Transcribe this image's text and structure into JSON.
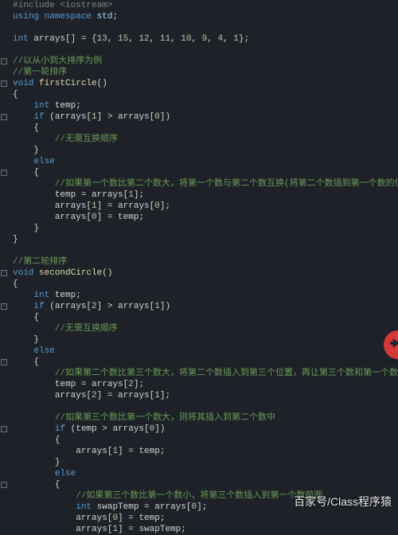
{
  "lines": [
    {
      "ind": 0,
      "fold": "",
      "tokens": [
        {
          "c": "gray",
          "t": "#include "
        },
        {
          "c": "gray",
          "t": "<iostream>"
        }
      ]
    },
    {
      "ind": 0,
      "fold": "",
      "tokens": [
        {
          "c": "kw",
          "t": "using"
        },
        {
          "c": "",
          "t": " "
        },
        {
          "c": "kw",
          "t": "namespace"
        },
        {
          "c": "",
          "t": " "
        },
        {
          "c": "ns",
          "t": "std"
        },
        {
          "c": "",
          "t": ";"
        }
      ]
    },
    {
      "ind": 0,
      "fold": "",
      "tokens": []
    },
    {
      "ind": 0,
      "fold": "",
      "tokens": [
        {
          "c": "type",
          "t": "int"
        },
        {
          "c": "",
          "t": " "
        },
        {
          "c": "ident",
          "t": "arrays"
        },
        {
          "c": "",
          "t": "[] = {"
        },
        {
          "c": "num",
          "t": "13"
        },
        {
          "c": "",
          "t": ", "
        },
        {
          "c": "num",
          "t": "15"
        },
        {
          "c": "",
          "t": ", "
        },
        {
          "c": "num",
          "t": "12"
        },
        {
          "c": "",
          "t": ", "
        },
        {
          "c": "num",
          "t": "11"
        },
        {
          "c": "",
          "t": ", "
        },
        {
          "c": "num",
          "t": "10"
        },
        {
          "c": "",
          "t": ", "
        },
        {
          "c": "num",
          "t": "9"
        },
        {
          "c": "",
          "t": ", "
        },
        {
          "c": "num",
          "t": "4"
        },
        {
          "c": "",
          "t": ", "
        },
        {
          "c": "num",
          "t": "1"
        },
        {
          "c": "",
          "t": "};"
        }
      ]
    },
    {
      "ind": 0,
      "fold": "",
      "tokens": []
    },
    {
      "ind": 0,
      "fold": "minus",
      "tokens": [
        {
          "c": "comment",
          "t": "//以从小到大排序为例"
        }
      ]
    },
    {
      "ind": 0,
      "fold": "",
      "tokens": [
        {
          "c": "comment",
          "t": "//第一轮排序"
        }
      ]
    },
    {
      "ind": 0,
      "fold": "minus",
      "tokens": [
        {
          "c": "type",
          "t": "void"
        },
        {
          "c": "",
          "t": " "
        },
        {
          "c": "func",
          "t": "firstCircle"
        },
        {
          "c": "",
          "t": "()"
        }
      ]
    },
    {
      "ind": 0,
      "fold": "",
      "tokens": [
        {
          "c": "",
          "t": "{"
        }
      ]
    },
    {
      "ind": 1,
      "fold": "",
      "tokens": [
        {
          "c": "type",
          "t": "int"
        },
        {
          "c": "",
          "t": " "
        },
        {
          "c": "ident",
          "t": "temp"
        },
        {
          "c": "",
          "t": ";"
        }
      ]
    },
    {
      "ind": 1,
      "fold": "minus",
      "tokens": [
        {
          "c": "kw",
          "t": "if"
        },
        {
          "c": "",
          "t": " ("
        },
        {
          "c": "ident",
          "t": "arrays"
        },
        {
          "c": "",
          "t": "["
        },
        {
          "c": "num",
          "t": "1"
        },
        {
          "c": "",
          "t": "] > "
        },
        {
          "c": "ident",
          "t": "arrays"
        },
        {
          "c": "",
          "t": "["
        },
        {
          "c": "num",
          "t": "0"
        },
        {
          "c": "",
          "t": "])"
        }
      ]
    },
    {
      "ind": 1,
      "fold": "",
      "tokens": [
        {
          "c": "",
          "t": "{"
        }
      ]
    },
    {
      "ind": 2,
      "fold": "",
      "tokens": [
        {
          "c": "comment",
          "t": "//无需互换顺序"
        }
      ]
    },
    {
      "ind": 1,
      "fold": "",
      "tokens": [
        {
          "c": "",
          "t": "}"
        }
      ]
    },
    {
      "ind": 1,
      "fold": "",
      "tokens": [
        {
          "c": "kw",
          "t": "else"
        }
      ]
    },
    {
      "ind": 1,
      "fold": "minus",
      "tokens": [
        {
          "c": "",
          "t": "{"
        }
      ]
    },
    {
      "ind": 2,
      "fold": "",
      "tokens": [
        {
          "c": "comment",
          "t": "//如果第一个数比第二个数大，将第一个数与第二个数互换(将第二个数插到第一个数的位置)"
        }
      ]
    },
    {
      "ind": 2,
      "fold": "",
      "tokens": [
        {
          "c": "ident",
          "t": "temp"
        },
        {
          "c": "",
          "t": " = "
        },
        {
          "c": "ident",
          "t": "arrays"
        },
        {
          "c": "",
          "t": "["
        },
        {
          "c": "num",
          "t": "1"
        },
        {
          "c": "",
          "t": "];"
        }
      ]
    },
    {
      "ind": 2,
      "fold": "",
      "tokens": [
        {
          "c": "ident",
          "t": "arrays"
        },
        {
          "c": "",
          "t": "["
        },
        {
          "c": "num",
          "t": "1"
        },
        {
          "c": "",
          "t": "] = "
        },
        {
          "c": "ident",
          "t": "arrays"
        },
        {
          "c": "",
          "t": "["
        },
        {
          "c": "num",
          "t": "0"
        },
        {
          "c": "",
          "t": "];"
        }
      ]
    },
    {
      "ind": 2,
      "fold": "",
      "tokens": [
        {
          "c": "ident",
          "t": "arrays"
        },
        {
          "c": "",
          "t": "["
        },
        {
          "c": "num",
          "t": "0"
        },
        {
          "c": "",
          "t": "] = "
        },
        {
          "c": "ident",
          "t": "temp"
        },
        {
          "c": "",
          "t": ";"
        }
      ]
    },
    {
      "ind": 1,
      "fold": "",
      "tokens": [
        {
          "c": "",
          "t": "}"
        }
      ]
    },
    {
      "ind": 0,
      "fold": "",
      "tokens": [
        {
          "c": "",
          "t": "}"
        }
      ]
    },
    {
      "ind": 0,
      "fold": "",
      "tokens": []
    },
    {
      "ind": 0,
      "fold": "",
      "tokens": [
        {
          "c": "comment",
          "t": "//第二轮排序"
        }
      ]
    },
    {
      "ind": 0,
      "fold": "minus",
      "tokens": [
        {
          "c": "type",
          "t": "void"
        },
        {
          "c": "",
          "t": " "
        },
        {
          "c": "func",
          "t": "secondCircle"
        },
        {
          "c": "",
          "t": "()"
        }
      ]
    },
    {
      "ind": 0,
      "fold": "",
      "tokens": [
        {
          "c": "",
          "t": "{"
        }
      ]
    },
    {
      "ind": 1,
      "fold": "",
      "tokens": [
        {
          "c": "type",
          "t": "int"
        },
        {
          "c": "",
          "t": " "
        },
        {
          "c": "ident",
          "t": "temp"
        },
        {
          "c": "",
          "t": ";"
        }
      ]
    },
    {
      "ind": 1,
      "fold": "minus",
      "tokens": [
        {
          "c": "kw",
          "t": "if"
        },
        {
          "c": "",
          "t": " ("
        },
        {
          "c": "ident",
          "t": "arrays"
        },
        {
          "c": "",
          "t": "["
        },
        {
          "c": "num",
          "t": "2"
        },
        {
          "c": "",
          "t": "] > "
        },
        {
          "c": "ident",
          "t": "arrays"
        },
        {
          "c": "",
          "t": "["
        },
        {
          "c": "num",
          "t": "1"
        },
        {
          "c": "",
          "t": "])"
        }
      ]
    },
    {
      "ind": 1,
      "fold": "",
      "tokens": [
        {
          "c": "",
          "t": "{"
        }
      ]
    },
    {
      "ind": 2,
      "fold": "",
      "tokens": [
        {
          "c": "comment",
          "t": "//无需互换顺序"
        }
      ]
    },
    {
      "ind": 1,
      "fold": "",
      "tokens": [
        {
          "c": "",
          "t": "}"
        }
      ]
    },
    {
      "ind": 1,
      "fold": "",
      "tokens": [
        {
          "c": "kw",
          "t": "else"
        }
      ]
    },
    {
      "ind": 1,
      "fold": "minus",
      "tokens": [
        {
          "c": "",
          "t": "{"
        }
      ]
    },
    {
      "ind": 2,
      "fold": "",
      "tokens": [
        {
          "c": "comment",
          "t": "//如果第二个数比第三个数大，将第二个数插入到第三个位置，再让第三个数和第一个数比较"
        }
      ]
    },
    {
      "ind": 2,
      "fold": "",
      "tokens": [
        {
          "c": "ident",
          "t": "temp"
        },
        {
          "c": "",
          "t": " = "
        },
        {
          "c": "ident",
          "t": "arrays"
        },
        {
          "c": "",
          "t": "["
        },
        {
          "c": "num",
          "t": "2"
        },
        {
          "c": "",
          "t": "];"
        }
      ]
    },
    {
      "ind": 2,
      "fold": "",
      "tokens": [
        {
          "c": "ident",
          "t": "arrays"
        },
        {
          "c": "",
          "t": "["
        },
        {
          "c": "num",
          "t": "2"
        },
        {
          "c": "",
          "t": "] = "
        },
        {
          "c": "ident",
          "t": "arrays"
        },
        {
          "c": "",
          "t": "["
        },
        {
          "c": "num",
          "t": "1"
        },
        {
          "c": "",
          "t": "];"
        }
      ]
    },
    {
      "ind": 2,
      "fold": "",
      "tokens": []
    },
    {
      "ind": 2,
      "fold": "",
      "tokens": [
        {
          "c": "comment",
          "t": "//如果第三个数比第一个数大，则将其插入到第二个数中"
        }
      ]
    },
    {
      "ind": 2,
      "fold": "minus",
      "tokens": [
        {
          "c": "kw",
          "t": "if"
        },
        {
          "c": "",
          "t": " ("
        },
        {
          "c": "ident",
          "t": "temp"
        },
        {
          "c": "",
          "t": " > "
        },
        {
          "c": "ident",
          "t": "arrays"
        },
        {
          "c": "",
          "t": "["
        },
        {
          "c": "num",
          "t": "0"
        },
        {
          "c": "",
          "t": "])"
        }
      ]
    },
    {
      "ind": 2,
      "fold": "",
      "tokens": [
        {
          "c": "",
          "t": "{"
        }
      ]
    },
    {
      "ind": 3,
      "fold": "",
      "tokens": [
        {
          "c": "ident",
          "t": "arrays"
        },
        {
          "c": "",
          "t": "["
        },
        {
          "c": "num",
          "t": "1"
        },
        {
          "c": "",
          "t": "] = "
        },
        {
          "c": "ident",
          "t": "temp"
        },
        {
          "c": "",
          "t": ";"
        }
      ]
    },
    {
      "ind": 2,
      "fold": "",
      "tokens": [
        {
          "c": "",
          "t": "}"
        }
      ]
    },
    {
      "ind": 2,
      "fold": "",
      "tokens": [
        {
          "c": "kw",
          "t": "else"
        }
      ]
    },
    {
      "ind": 2,
      "fold": "minus",
      "tokens": [
        {
          "c": "",
          "t": "{"
        }
      ]
    },
    {
      "ind": 3,
      "fold": "",
      "tokens": [
        {
          "c": "comment",
          "t": "//如果第三个数比第一个数小，将第三个数插入到第一个数前面"
        }
      ]
    },
    {
      "ind": 3,
      "fold": "",
      "tokens": [
        {
          "c": "type",
          "t": "int"
        },
        {
          "c": "",
          "t": " "
        },
        {
          "c": "ident",
          "t": "swapTemp"
        },
        {
          "c": "",
          "t": " = "
        },
        {
          "c": "ident",
          "t": "arrays"
        },
        {
          "c": "",
          "t": "["
        },
        {
          "c": "num",
          "t": "0"
        },
        {
          "c": "",
          "t": "];"
        }
      ]
    },
    {
      "ind": 3,
      "fold": "",
      "tokens": [
        {
          "c": "ident",
          "t": "arrays"
        },
        {
          "c": "",
          "t": "["
        },
        {
          "c": "num",
          "t": "0"
        },
        {
          "c": "",
          "t": "] = "
        },
        {
          "c": "ident",
          "t": "temp"
        },
        {
          "c": "",
          "t": ";"
        }
      ]
    },
    {
      "ind": 3,
      "fold": "",
      "tokens": [
        {
          "c": "ident",
          "t": "arrays"
        },
        {
          "c": "",
          "t": "["
        },
        {
          "c": "num",
          "t": "1"
        },
        {
          "c": "",
          "t": "] = "
        },
        {
          "c": "ident",
          "t": "swapTemp"
        },
        {
          "c": "",
          "t": ";"
        }
      ]
    }
  ],
  "watermark": "百家号/Class程序猿"
}
